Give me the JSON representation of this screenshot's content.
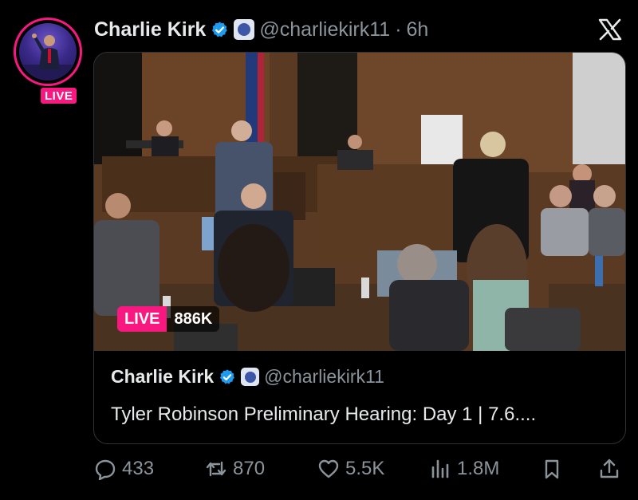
{
  "author": {
    "name": "Charlie Kirk",
    "handle": "@charliekirk11",
    "separator": "·",
    "time": "6h",
    "live_badge": "LIVE"
  },
  "card": {
    "live_label": "LIVE",
    "viewers": "886K",
    "quote": {
      "name": "Charlie Kirk",
      "handle": "@charliekirk11",
      "title": "Tyler Robinson Preliminary Hearing: Day 1 | 7.6...."
    }
  },
  "actions": {
    "replies": "433",
    "reposts": "870",
    "likes": "5.5K",
    "views": "1.8M"
  },
  "icons": [
    "x-logo-icon",
    "verified-icon",
    "affiliate-badge-icon",
    "reply-icon",
    "repost-icon",
    "like-icon",
    "views-icon",
    "bookmark-icon",
    "share-icon"
  ],
  "colors": {
    "live": "#f91880",
    "verified": "#1d9bf0",
    "muted": "#8b949a",
    "text": "#e7e9ea",
    "background": "#000000"
  }
}
